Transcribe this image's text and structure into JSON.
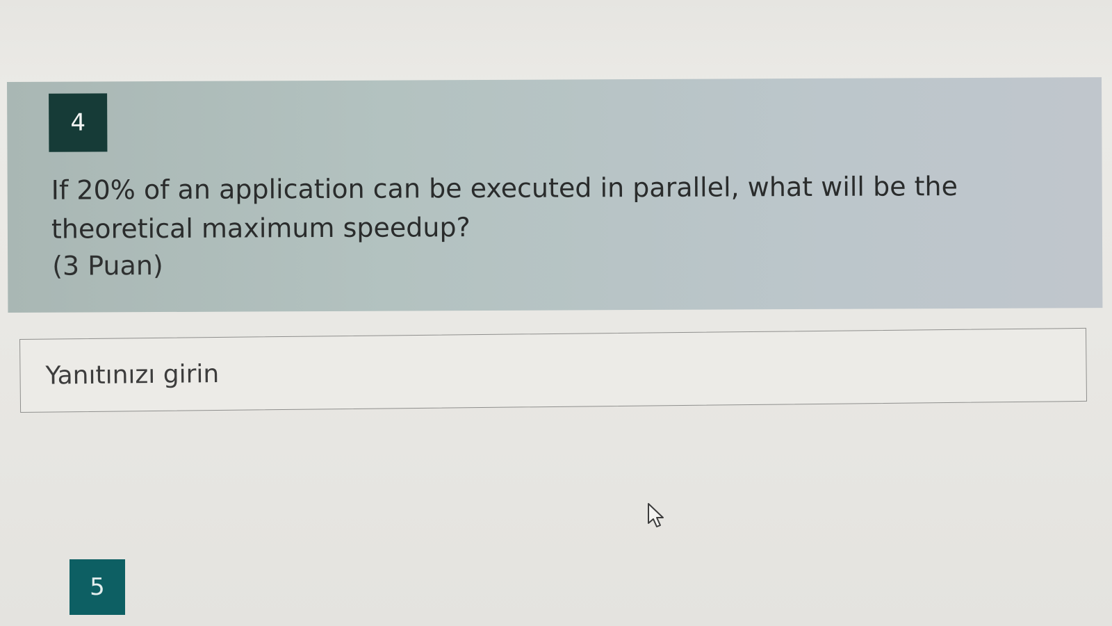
{
  "question": {
    "number": "4",
    "text": "If 20% of an application can be executed in parallel, what will be the theoretical maximum speedup?",
    "points": "(3 Puan)"
  },
  "answer": {
    "placeholder": "Yanıtınızı girin",
    "value": ""
  },
  "next_question": {
    "number": "5"
  },
  "icons": {
    "pointer": "mouse-pointer-icon"
  },
  "colors": {
    "question_badge": "#163b37",
    "next_question_badge": "#0d5f63",
    "question_card_bg": "#b3c2c0",
    "page_bg": "#e9e8e4"
  }
}
